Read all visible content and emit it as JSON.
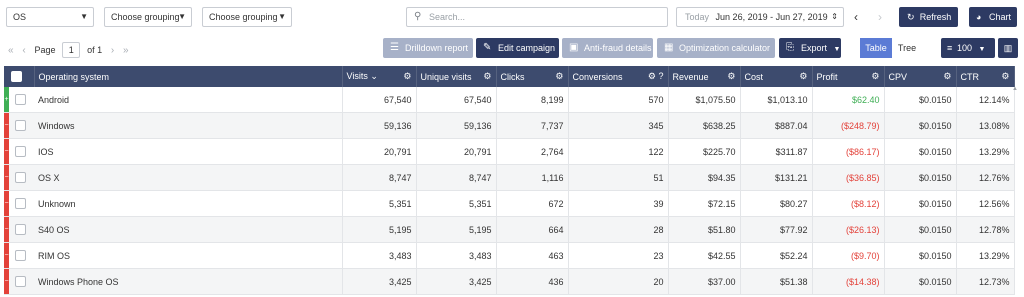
{
  "filters": {
    "group1": "OS",
    "group2": "Choose grouping",
    "group3": "Choose grouping",
    "search_placeholder": "Search...",
    "date_prefix": "Today",
    "date_range": "Jun 26, 2019 - Jun 27, 2019"
  },
  "top_buttons": {
    "refresh": "Refresh",
    "chart": "Chart"
  },
  "pager": {
    "page_label": "Page",
    "page_value": "1",
    "of_label": "of 1"
  },
  "toolbar": {
    "drilldown": "Drilldown report",
    "edit_campaign": "Edit campaign",
    "antifraud": "Anti-fraud details",
    "optimization": "Optimization calculator",
    "export": "Export",
    "table": "Table",
    "tree": "Tree",
    "per_page": "100"
  },
  "columns": [
    "Operating system",
    "Visits",
    "Unique visits",
    "Clicks",
    "Conversions",
    "Revenue",
    "Cost",
    "Profit",
    "CPV",
    "CTR"
  ],
  "rows": [
    {
      "os": "Android",
      "visits": "67,540",
      "unique": "67,540",
      "clicks": "8,199",
      "conv": "570",
      "revenue": "$1,075.50",
      "cost": "$1,013.10",
      "profit": "$62.40",
      "cpv": "$0.0150",
      "ctr": "12.14%"
    },
    {
      "os": "Windows",
      "visits": "59,136",
      "unique": "59,136",
      "clicks": "7,737",
      "conv": "345",
      "revenue": "$638.25",
      "cost": "$887.04",
      "profit": "($248.79)",
      "cpv": "$0.0150",
      "ctr": "13.08%"
    },
    {
      "os": "IOS",
      "visits": "20,791",
      "unique": "20,791",
      "clicks": "2,764",
      "conv": "122",
      "revenue": "$225.70",
      "cost": "$311.87",
      "profit": "($86.17)",
      "cpv": "$0.0150",
      "ctr": "13.29%"
    },
    {
      "os": "OS X",
      "visits": "8,747",
      "unique": "8,747",
      "clicks": "1,116",
      "conv": "51",
      "revenue": "$94.35",
      "cost": "$131.21",
      "profit": "($36.85)",
      "cpv": "$0.0150",
      "ctr": "12.76%"
    },
    {
      "os": "Unknown",
      "visits": "5,351",
      "unique": "5,351",
      "clicks": "672",
      "conv": "39",
      "revenue": "$72.15",
      "cost": "$80.27",
      "profit": "($8.12)",
      "cpv": "$0.0150",
      "ctr": "12.56%"
    },
    {
      "os": "S40 OS",
      "visits": "5,195",
      "unique": "5,195",
      "clicks": "664",
      "conv": "28",
      "revenue": "$51.80",
      "cost": "$77.92",
      "profit": "($26.13)",
      "cpv": "$0.0150",
      "ctr": "12.78%"
    },
    {
      "os": "RIM OS",
      "visits": "3,483",
      "unique": "3,483",
      "clicks": "463",
      "conv": "23",
      "revenue": "$42.55",
      "cost": "$52.24",
      "profit": "($9.70)",
      "cpv": "$0.0150",
      "ctr": "13.29%"
    },
    {
      "os": "Windows Phone OS",
      "visits": "3,425",
      "unique": "3,425",
      "clicks": "436",
      "conv": "20",
      "revenue": "$37.00",
      "cost": "$51.38",
      "profit": "($14.38)",
      "cpv": "$0.0150",
      "ctr": "12.73%"
    }
  ],
  "colors": {
    "header": "#3d4b6e",
    "dark_button": "#2d3a63",
    "positive": "#3faf55",
    "negative": "#e3423a"
  }
}
